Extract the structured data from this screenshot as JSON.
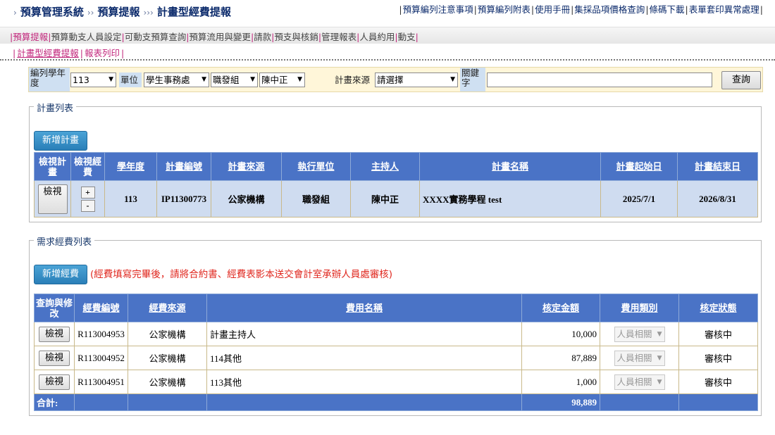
{
  "breadcrumb": [
    "預算管理系統",
    "預算提報",
    "計畫型經費提報"
  ],
  "top_links": [
    "預算編列注意事項",
    "預算編列附表",
    "使用手冊",
    "集採品項價格查詢",
    "條碼下載",
    "表單套印異常處理"
  ],
  "menu": [
    "預算提報",
    "預算動支人員設定",
    "可動支預算查詢",
    "預算流用與變更",
    "請款",
    "預支與核銷",
    "管理報表",
    "人員約用",
    "動支"
  ],
  "submenu": [
    "計畫型經費提報",
    "報表列印"
  ],
  "filters": {
    "year_label": "編列學年度",
    "year_value": "113",
    "unit_label": "單位",
    "unit_value": "學生事務處",
    "group_value": "職發組",
    "person_value": "陳中正",
    "source_label": "計畫來源",
    "source_value": "請選擇",
    "keyword_label": "關鍵字",
    "keyword_value": "",
    "search_button": "查詢"
  },
  "plan_section": {
    "legend": "計畫列表",
    "add_button": "新增計畫",
    "columns": [
      "檢視計畫",
      "檢視經費",
      "學年度",
      "計畫編號",
      "計畫來源",
      "執行單位",
      "主持人",
      "計畫名稱",
      "計畫起始日",
      "計畫結束日"
    ],
    "rows": [
      {
        "view_button": "檢視",
        "expand_plus": "+",
        "expand_minus": "-",
        "year": "113",
        "plan_no": "IP11300773",
        "source": "公家機構",
        "unit": "職發組",
        "host": "陳中正",
        "name": "XXXX實務學程 test",
        "start": "2025/7/1",
        "end": "2026/8/31"
      }
    ]
  },
  "expense_section": {
    "legend": "需求經費列表",
    "add_button": "新增經費",
    "notice": "(經費填寫完畢後，請將合約書、經費表影本送交會計室承辦人員處審核)",
    "columns": [
      "查詢與修改",
      "經費編號",
      "經費來源",
      "費用名稱",
      "核定金額",
      "費用類別",
      "核定狀態"
    ],
    "rows": [
      {
        "view_button": "檢視",
        "no": "R113004953",
        "source": "公家機構",
        "name": "計畫主持人",
        "amount": "10,000",
        "category": "人員相關",
        "status": "審核中"
      },
      {
        "view_button": "檢視",
        "no": "R113004952",
        "source": "公家機構",
        "name": "114其他",
        "amount": "87,889",
        "category": "人員相關",
        "status": "審核中"
      },
      {
        "view_button": "檢視",
        "no": "R113004951",
        "source": "公家機構",
        "name": "113其他",
        "amount": "1,000",
        "category": "人員相關",
        "status": "審核中"
      }
    ],
    "total_label": "合計:",
    "total_amount": "98,889"
  },
  "colors": {
    "header_blue": "#4a73c6",
    "plan_row_bg": "#cfdcf0",
    "add_button_blue": "#2a7fb8",
    "notice_red": "#e0281f",
    "menu_active": "#c2277c",
    "filter_bg": "#fff6d9"
  }
}
